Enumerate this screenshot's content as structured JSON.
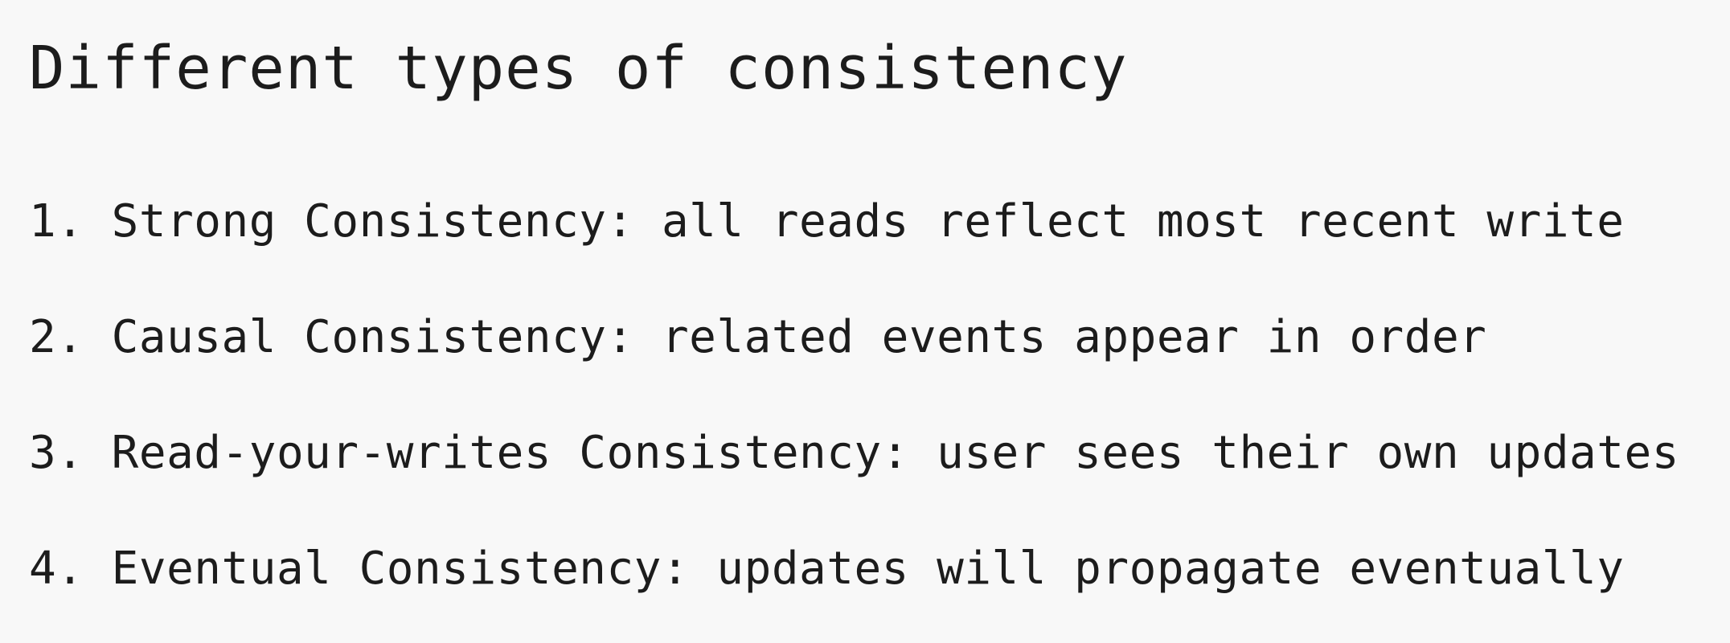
{
  "title": "Different types of consistency",
  "items": [
    {
      "number": "1.",
      "text": "Strong Consistency: all reads reflect most recent write"
    },
    {
      "number": "2.",
      "text": "Causal Consistency: related events appear in order"
    },
    {
      "number": "3.",
      "text": "Read-your-writes Consistency: user sees their own updates"
    },
    {
      "number": "4.",
      "text": "Eventual Consistency: updates will propagate eventually"
    }
  ]
}
